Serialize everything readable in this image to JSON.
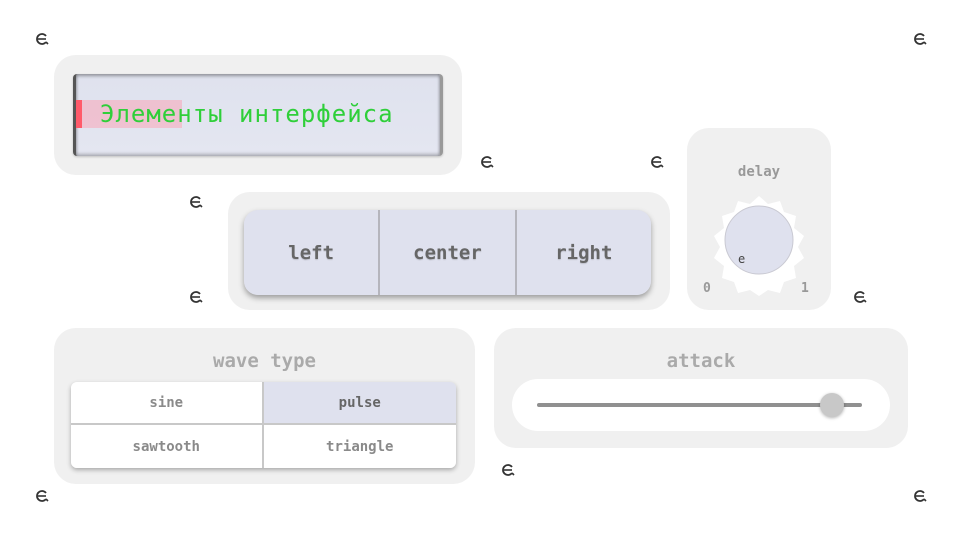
{
  "title": {
    "text": "Элементы интерфейса"
  },
  "alignment": {
    "options": [
      {
        "label": "left"
      },
      {
        "label": "center"
      },
      {
        "label": "right"
      }
    ]
  },
  "delay": {
    "label": "delay",
    "min": "0",
    "max": "1",
    "value": 0.05
  },
  "wave_type": {
    "label": "wave type",
    "options": [
      {
        "label": "sine",
        "selected": false
      },
      {
        "label": "pulse",
        "selected": true
      },
      {
        "label": "sawtooth",
        "selected": false
      },
      {
        "label": "triangle",
        "selected": false
      }
    ]
  },
  "attack": {
    "label": "attack",
    "value": 0.95
  },
  "icons": {
    "scattered": "loop-cursor-icon"
  },
  "colors": {
    "title_text": "#2fcf3a",
    "selection": "#dfe1ee",
    "cursor_highlight": "#ff5a6a"
  }
}
